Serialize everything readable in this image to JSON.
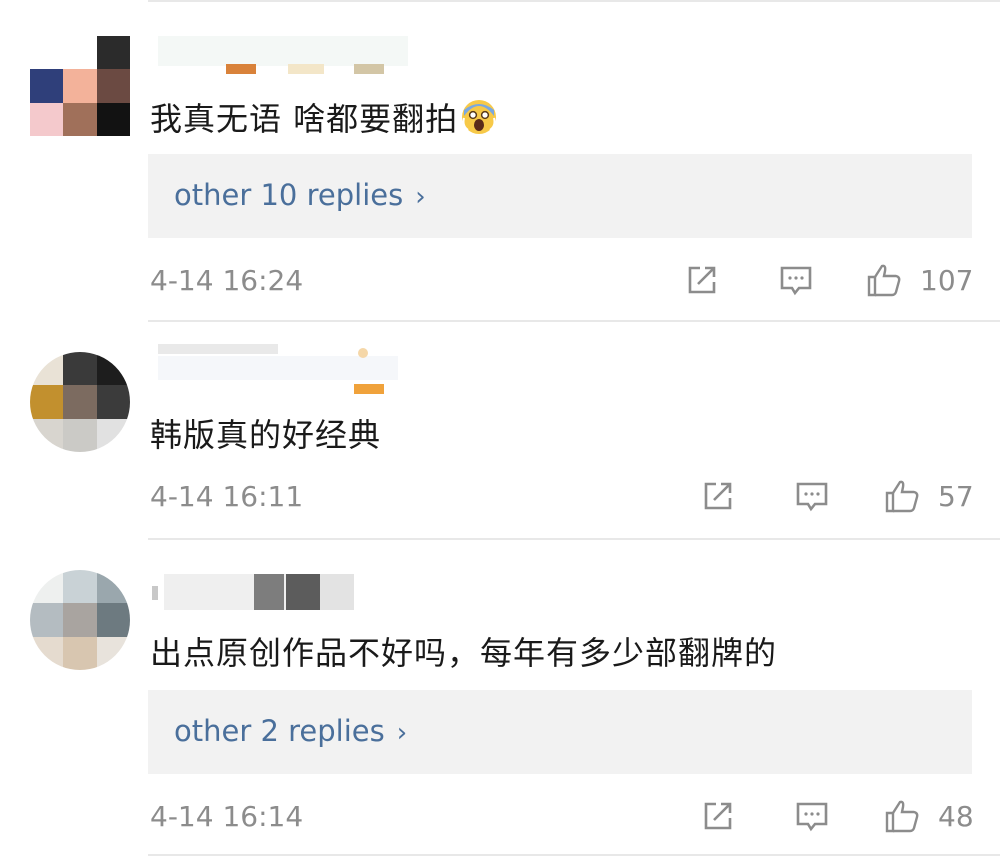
{
  "colors": {
    "reply_link": "#4a6f9b",
    "meta_text": "#8c8c8c",
    "reply_bg": "#f2f2f2",
    "divider": "#e8e8e8"
  },
  "icons": {
    "repost": "repost-icon",
    "comment": "comment-icon",
    "like": "thumbs-up-icon",
    "emoji": "scream-face-emoji"
  },
  "comments": [
    {
      "text": "我真无语 啥都要翻拍",
      "replies_label": "other 10 replies",
      "timestamp": "4-14 16:24",
      "likes": "107"
    },
    {
      "text": "韩版真的好经典",
      "timestamp": "4-14 16:11",
      "likes": "57"
    },
    {
      "text": "出点原创作品不好吗，每年有多少部翻牌的",
      "replies_label": "other 2 replies",
      "timestamp": "4-14 16:14",
      "likes": "48"
    }
  ]
}
